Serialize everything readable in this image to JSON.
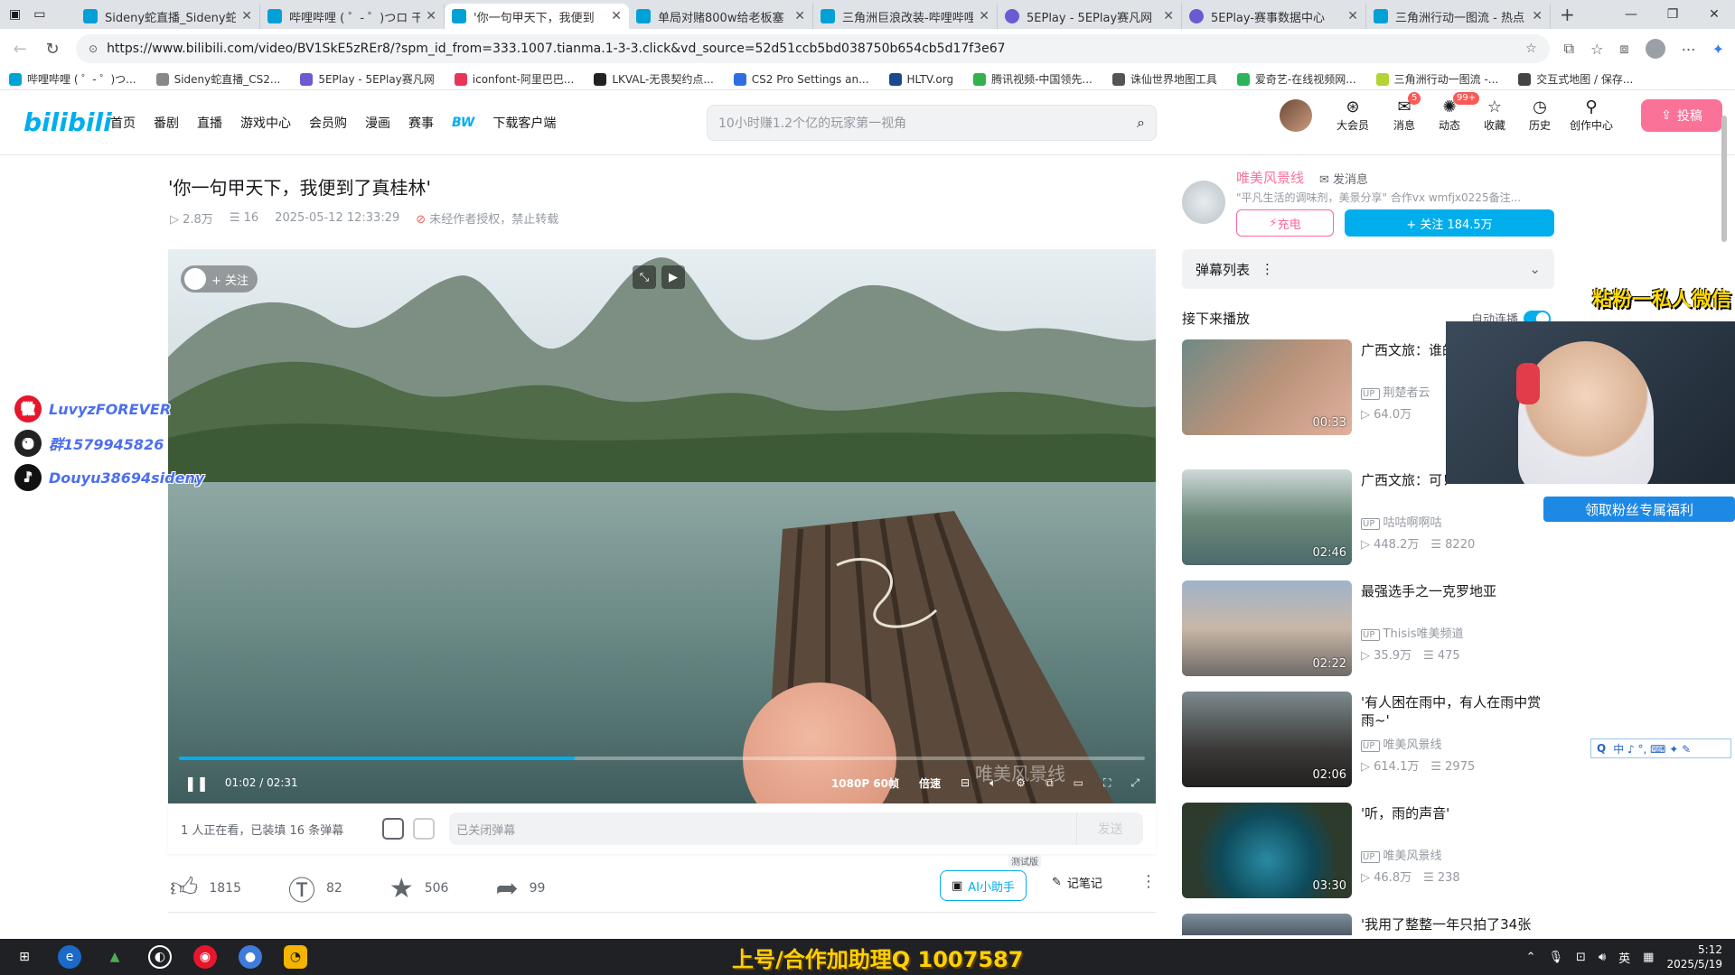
{
  "browser": {
    "tabs": [
      {
        "title": "Sideny蛇直播_Sideny蛇直播",
        "active": false
      },
      {
        "title": "哔哩哔哩 ( ゜- ゜)つロ 干杯",
        "active": false
      },
      {
        "title": "'你一句甲天下，我便到",
        "active": true
      },
      {
        "title": "单局对赌800w给老板塞",
        "active": false
      },
      {
        "title": "三角洲巨浪改装-哔哩哔哩",
        "active": false
      },
      {
        "title": "5EPlay - 5EPlay赛凡网",
        "active": false
      },
      {
        "title": "5EPlay-赛事数据中心",
        "active": false
      },
      {
        "title": "三角洲行动一图流 - 热点",
        "active": false
      }
    ],
    "url": "https://www.bilibili.com/video/BV1SkE5zREr8/?spm_id_from=333.1007.tianma.1-3-3.click&vd_source=52d51ccb5bd038750b654cb5d17f3e67",
    "bookmarks": [
      "哔哩哔哩 ( ゜- ゜)つ...",
      "Sideny蛇直播_CS2...",
      "5EPlay - 5EPlay赛凡网",
      "iconfont-阿里巴巴...",
      "LKVAL-无畏契约点...",
      "CS2 Pro Settings an...",
      "HLTV.org",
      "腾讯视频-中国领先...",
      "诛仙世界地图工具",
      "爱奇艺-在线视频网...",
      "三角洲行动一图流 -...",
      "交互式地图 / 保存..."
    ]
  },
  "header": {
    "logo": "bilibili",
    "nav": [
      "首页",
      "番剧",
      "直播",
      "游戏中心",
      "会员购",
      "漫画",
      "赛事",
      "BW",
      "下载客户端"
    ],
    "search_placeholder": "10小时赚1.2个亿的玩家第一视角",
    "right_items": [
      {
        "label": "大会员",
        "icon": "vip-icon",
        "badge": ""
      },
      {
        "label": "消息",
        "icon": "message-icon",
        "badge": "5"
      },
      {
        "label": "动态",
        "icon": "dynamic-icon",
        "badge": "99+"
      },
      {
        "label": "收藏",
        "icon": "favorite-icon",
        "badge": ""
      },
      {
        "label": "历史",
        "icon": "history-icon",
        "badge": ""
      },
      {
        "label": "创作中心",
        "icon": "creator-icon",
        "badge": ""
      }
    ],
    "upload_label": "投稿"
  },
  "video": {
    "title": "'你一句甲天下，我便到了真桂林'",
    "views": "2.8万",
    "danmaku_count": "16",
    "date": "2025-05-12 12:33:29",
    "copyright": "未经作者授权，禁止转载",
    "follow_chip": "+ 关注",
    "time_current": "01:02",
    "time_total": "02:31",
    "progress_fraction": 0.41,
    "quality": "1080P 60帧",
    "speed_label": "倍速",
    "watermark": "唯美风景线"
  },
  "danmaku_bar": {
    "viewers": "1 人正在看，已装填 16 条弹幕",
    "placeholder": "已关闭弹幕",
    "send_label": "发送"
  },
  "actions": {
    "like": "1815",
    "coin": "82",
    "favorite": "506",
    "share": "99",
    "ai_label": "AI小助手",
    "beta": "测试版",
    "note_label": "记笔记"
  },
  "up": {
    "name": "唯美风景线",
    "msg_label": "发消息",
    "desc": "\"平凡生活的调味剂，美景分享\" 合作vx wmfjx0225备注...",
    "charge_label": "充电",
    "follow_label": "+ 关注 184.5万"
  },
  "sidebar": {
    "danmu_list_label": "弹幕列表",
    "next_title": "接下来播放",
    "autoplay_label": "自动连播",
    "recommendations": [
      {
        "title": "广西文旅：谁的？",
        "up": "荆楚者云",
        "views": "64.0万",
        "danmaku": "",
        "duration": "00:33"
      },
      {
        "title": "广西文旅：可！",
        "up": "咕咕啊啊咕",
        "views": "448.2万",
        "danmaku": "8220",
        "duration": "02:46"
      },
      {
        "title": "最强选手之一克罗地亚",
        "up": "Thisis唯美频道",
        "views": "35.9万",
        "danmaku": "475",
        "duration": "02:22"
      },
      {
        "title": "'有人困在雨中，有人在雨中赏雨~'",
        "up": "唯美风景线",
        "views": "614.1万",
        "danmaku": "2975",
        "duration": "02:06"
      },
      {
        "title": "'听，雨的声音'",
        "up": "唯美风景线",
        "views": "46.8万",
        "danmaku": "238",
        "duration": "03:30"
      },
      {
        "title": "'我用了整整一年只拍了34张",
        "up": "",
        "views": "",
        "danmaku": "",
        "duration": ""
      }
    ]
  },
  "overlay": {
    "social": [
      {
        "text": "LuvyzFOREVER",
        "icon": "weibo-icon",
        "color": "#e6162d"
      },
      {
        "text": "群1579945826",
        "icon": "qq-icon",
        "color": "#222222"
      },
      {
        "text": "Douyu38694sideny",
        "icon": "tiktok-icon",
        "color": "#111111"
      }
    ],
    "fan_text": "粘粉一私人微信",
    "fan_button": "领取粉丝专属福利",
    "ime": "中 ♪ °, ⌨ ✦ ✎",
    "taskbar_banner": "上号/合作加助理Q 1007587"
  },
  "tray": {
    "lang": "英",
    "time": "5:12",
    "date": "2025/5/19"
  }
}
